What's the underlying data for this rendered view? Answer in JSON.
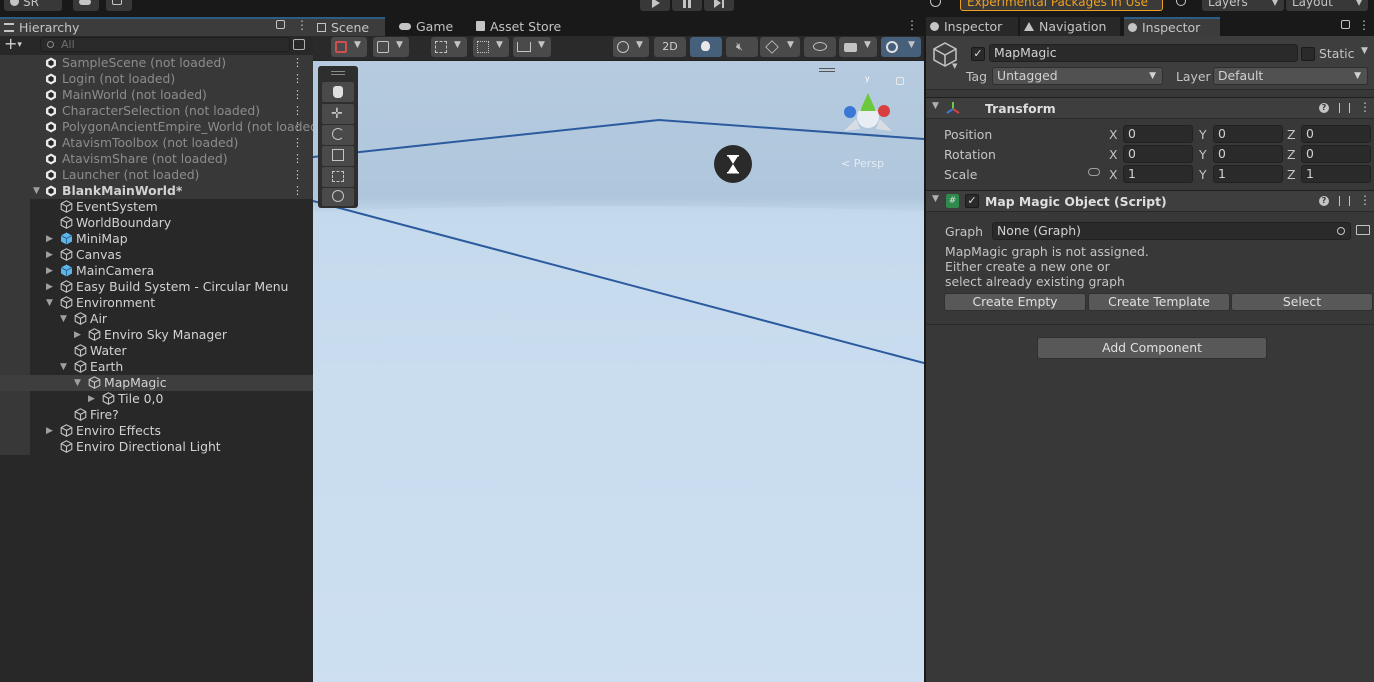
{
  "topbar": {
    "account_label": "SR",
    "packages_label": "Experimental Packages In Use",
    "layers_label": "Layers",
    "layout_label": "Layout"
  },
  "hierarchy": {
    "tab_label": "Hierarchy",
    "search_placeholder": "All",
    "scenes": [
      {
        "label": "SampleScene (not loaded)"
      },
      {
        "label": "Login (not loaded)"
      },
      {
        "label": "MainWorld (not loaded)"
      },
      {
        "label": "CharacterSelection (not loaded)"
      },
      {
        "label": "PolygonAncientEmpire_World (not loaded)"
      },
      {
        "label": "AtavismToolbox (not loaded)"
      },
      {
        "label": "AtavismShare (not loaded)"
      },
      {
        "label": "Launcher (not loaded)"
      }
    ],
    "active_scene": "BlankMainWorld*",
    "objects": [
      {
        "label": "EventSystem",
        "indent": 0,
        "expand": "",
        "icon": "gameobject-icon"
      },
      {
        "label": "WorldBoundary",
        "indent": 0,
        "expand": "",
        "icon": "gameobject-icon"
      },
      {
        "label": "MiniMap",
        "indent": 0,
        "expand": "collapsed",
        "icon": "prefab-icon"
      },
      {
        "label": "Canvas",
        "indent": 0,
        "expand": "collapsed",
        "icon": "gameobject-icon"
      },
      {
        "label": "MainCamera",
        "indent": 0,
        "expand": "collapsed",
        "icon": "prefab-icon"
      },
      {
        "label": "Easy Build System - Circular Menu",
        "indent": 0,
        "expand": "collapsed",
        "icon": "gameobject-icon"
      },
      {
        "label": "Environment",
        "indent": 0,
        "expand": "expanded",
        "icon": "gameobject-icon"
      },
      {
        "label": "Air",
        "indent": 1,
        "expand": "expanded",
        "icon": "gameobject-icon"
      },
      {
        "label": "Enviro Sky Manager",
        "indent": 2,
        "expand": "collapsed",
        "icon": "gameobject-icon"
      },
      {
        "label": "Water",
        "indent": 1,
        "expand": "",
        "icon": "gameobject-icon"
      },
      {
        "label": "Earth",
        "indent": 1,
        "expand": "expanded",
        "icon": "gameobject-icon"
      },
      {
        "label": "MapMagic",
        "indent": 2,
        "expand": "expanded",
        "icon": "gameobject-icon",
        "selected": true
      },
      {
        "label": "Tile 0,0",
        "indent": 3,
        "expand": "collapsed",
        "icon": "gameobject-icon"
      },
      {
        "label": "Fire?",
        "indent": 1,
        "expand": "",
        "icon": "gameobject-icon"
      },
      {
        "label": "Enviro Effects",
        "indent": 0,
        "expand": "collapsed",
        "icon": "gameobject-icon"
      },
      {
        "label": "Enviro Directional Light",
        "indent": 0,
        "expand": "",
        "icon": "gameobject-icon"
      }
    ]
  },
  "scene_view": {
    "tabs": [
      {
        "label": "Scene",
        "icon": "grid-icon"
      },
      {
        "label": "Game",
        "icon": "gamepad-icon"
      },
      {
        "label": "Asset Store",
        "icon": "store-icon"
      }
    ],
    "toggle_2d": "2D",
    "persp_label": "< Persp"
  },
  "inspector": {
    "tabs": [
      {
        "label": "Inspector"
      },
      {
        "label": "Navigation"
      },
      {
        "label": "Inspector"
      }
    ],
    "object_name": "MapMagic",
    "static_label": "Static",
    "tag_label": "Tag",
    "tag_value": "Untagged",
    "layer_label": "Layer",
    "layer_value": "Default",
    "transform": {
      "title": "Transform",
      "rows": [
        {
          "label": "Position",
          "x": "0",
          "y": "0",
          "z": "0"
        },
        {
          "label": "Rotation",
          "x": "0",
          "y": "0",
          "z": "0"
        },
        {
          "label": "Scale",
          "x": "1",
          "y": "1",
          "z": "1"
        }
      ],
      "axis": [
        "X",
        "Y",
        "Z"
      ]
    },
    "script": {
      "title": "Map Magic Object (Script)",
      "graph_label": "Graph",
      "graph_value": "None (Graph)",
      "message_lines": [
        "MapMagic graph is not assigned.",
        "Either create a new one or",
        "select already existing graph"
      ],
      "buttons": [
        "Create Empty",
        "Create Template",
        "Select"
      ]
    },
    "add_component": "Add Component"
  },
  "colors": {
    "accent": "#2c5d87",
    "selection": "#2c5d87",
    "packages": "#f0a020"
  }
}
